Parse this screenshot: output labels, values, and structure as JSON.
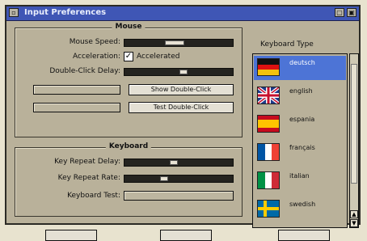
{
  "window": {
    "title": "Input Preferences"
  },
  "mouse": {
    "group_title": "Mouse",
    "speed_label": "Mouse Speed:",
    "speed_level": 0.45,
    "acceleration_label": "Acceleration:",
    "accelerated_checked": true,
    "accelerated_label": "Accelerated",
    "double_click_label": "Double-Click Delay:",
    "double_click_level": 0.55,
    "show_double_click_button": "Show Double-Click",
    "test_double_click_button": "Test Double-Click"
  },
  "keyboard": {
    "group_title": "Keyboard",
    "repeat_delay_label": "Key Repeat Delay:",
    "repeat_delay_level": 0.45,
    "repeat_rate_label": "Key Repeat Rate:",
    "repeat_rate_level": 0.35,
    "test_label": "Keyboard Test:"
  },
  "keyboard_type": {
    "title": "Keyboard Type",
    "items": [
      {
        "label": "deutsch",
        "flag": "germany-flag",
        "selected": true
      },
      {
        "label": "english",
        "flag": "uk-flag",
        "selected": false
      },
      {
        "label": "espania",
        "flag": "spain-flag",
        "selected": false
      },
      {
        "label": "français",
        "flag": "france-flag",
        "selected": false
      },
      {
        "label": "italian",
        "flag": "italy-flag",
        "selected": false
      },
      {
        "label": "swedish",
        "flag": "sweden-flag",
        "selected": false
      }
    ]
  },
  "colors": {
    "title_bar": "#3f56b5",
    "selection": "#4d74d6",
    "panel": "#b9b19a"
  }
}
